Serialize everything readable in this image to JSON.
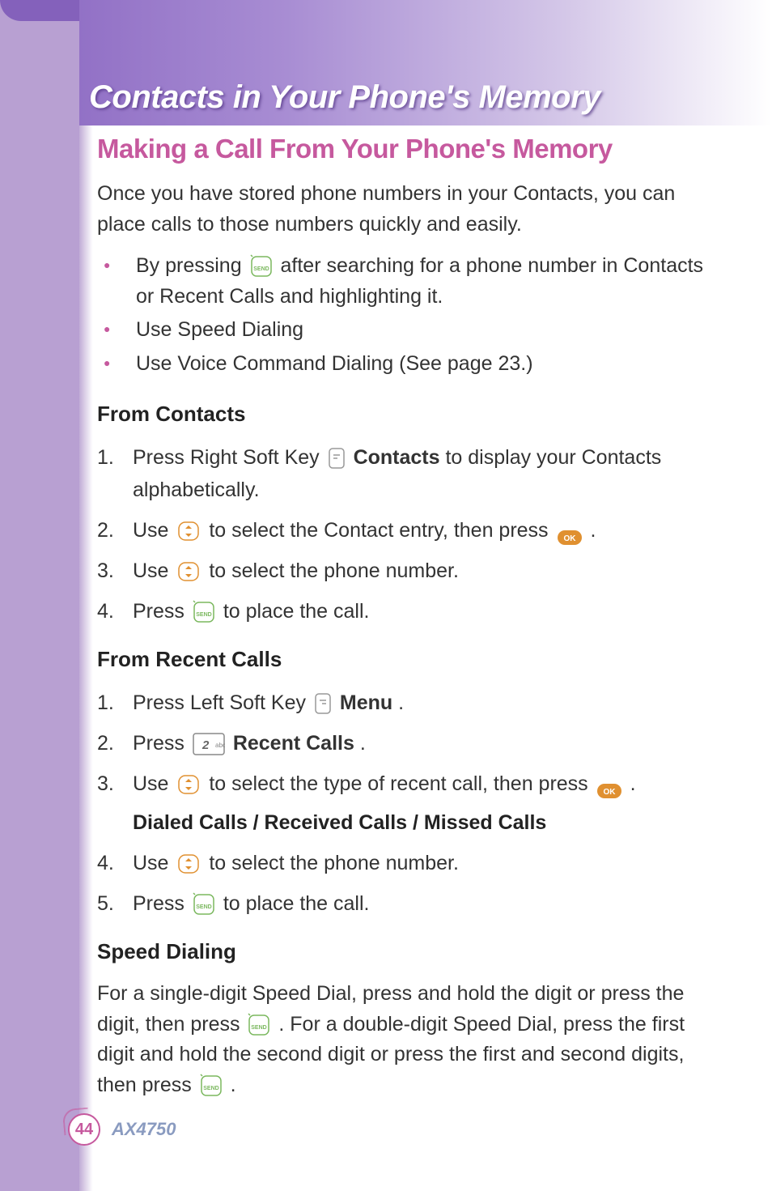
{
  "main_title": "Contacts in Your Phone's Memory",
  "section_title": "Making a Call From Your Phone's Memory",
  "intro_text": "Once you have stored phone numbers in your Contacts, you can place calls to those numbers quickly and easily.",
  "bullets": {
    "item1_pre": "By pressing ",
    "item1_post": " after searching for a phone number in Contacts or Recent Calls and highlighting it.",
    "item2": "Use Speed Dialing",
    "item3": "Use Voice Command Dialing (See page 23.)"
  },
  "from_contacts": {
    "heading": "From Contacts",
    "step1_pre": "Press Right Soft Key ",
    "step1_bold": "Contacts",
    "step1_post": " to display your Contacts alphabetically.",
    "step2_pre": "Use ",
    "step2_mid": " to select the Contact entry, then press ",
    "step2_post": ".",
    "step3_pre": "Use ",
    "step3_post": " to select the phone number.",
    "step4_pre": "Press ",
    "step4_post": " to place the call."
  },
  "from_recent": {
    "heading": "From Recent Calls",
    "step1_pre": "Press Left Soft Key ",
    "step1_bold": "Menu",
    "step1_post": ".",
    "step2_pre": "Press ",
    "step2_bold": "Recent Calls",
    "step2_post": ".",
    "step3_pre": "Use ",
    "step3_mid": " to select the type of recent call, then press ",
    "step3_post": ".",
    "step3_options": "Dialed Calls / Received Calls / Missed Calls",
    "step4_pre": "Use ",
    "step4_post": " to select the phone number.",
    "step5_pre": "Press ",
    "step5_post": " to place the call."
  },
  "speed_dialing": {
    "heading": "Speed Dialing",
    "text_pre": "For a single-digit Speed Dial, press and hold the digit or press the digit, then press ",
    "text_mid": " . For a double-digit Speed Dial, press the first digit and hold the second digit or press the first and second digits, then press ",
    "text_post": " ."
  },
  "footer": {
    "page_number": "44",
    "model": "AX4750"
  }
}
